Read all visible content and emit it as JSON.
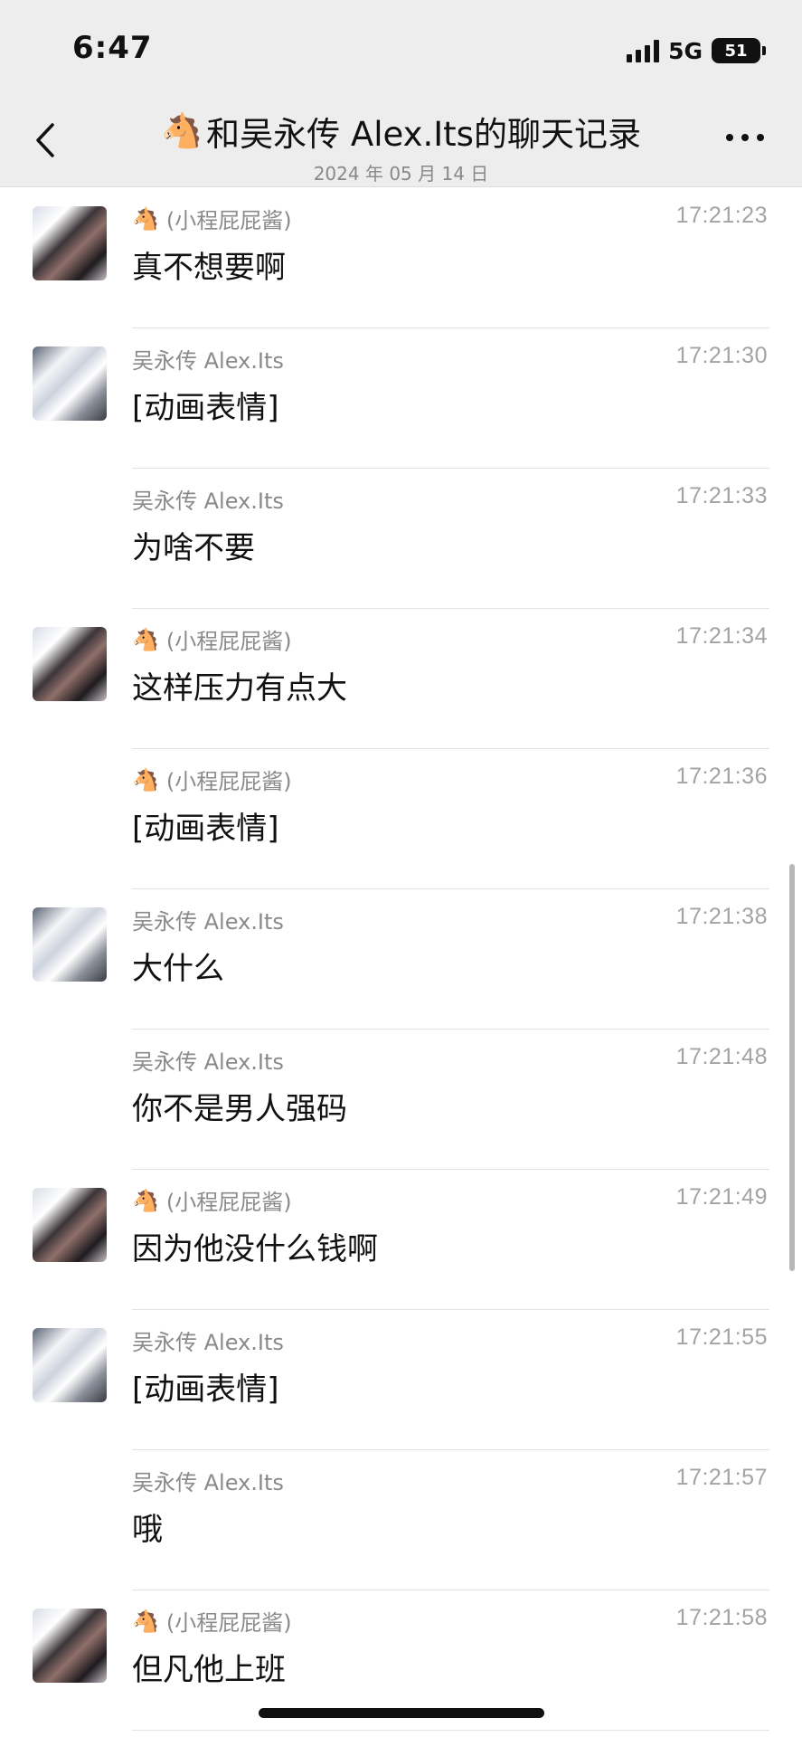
{
  "status_bar": {
    "time": "6:47",
    "network": "5G",
    "battery": "51"
  },
  "header": {
    "title_emoji": "🐴",
    "title": "和吴永传 Alex.Its的聊天记录",
    "date": "2024 年 05 月 14 日"
  },
  "messages": [
    {
      "avatar": "avatar-dark",
      "emoji": "🐴",
      "sender": "(小程屁屁酱)",
      "time": "17:21:23",
      "text": "真不想要啊"
    },
    {
      "avatar": "avatar-white",
      "emoji": "",
      "sender": "吴永传 Alex.Its",
      "time": "17:21:30",
      "text": "[动画表情]"
    },
    {
      "avatar": "",
      "emoji": "",
      "sender": "吴永传 Alex.Its",
      "time": "17:21:33",
      "text": "为啥不要"
    },
    {
      "avatar": "avatar-dark",
      "emoji": "🐴",
      "sender": "(小程屁屁酱)",
      "time": "17:21:34",
      "text": "这样压力有点大"
    },
    {
      "avatar": "",
      "emoji": "🐴",
      "sender": "(小程屁屁酱)",
      "time": "17:21:36",
      "text": "[动画表情]"
    },
    {
      "avatar": "avatar-white",
      "emoji": "",
      "sender": "吴永传 Alex.Its",
      "time": "17:21:38",
      "text": "大什么"
    },
    {
      "avatar": "",
      "emoji": "",
      "sender": "吴永传 Alex.Its",
      "time": "17:21:48",
      "text": "你不是男人强码"
    },
    {
      "avatar": "avatar-dark",
      "emoji": "🐴",
      "sender": "(小程屁屁酱)",
      "time": "17:21:49",
      "text": "因为他没什么钱啊"
    },
    {
      "avatar": "avatar-white",
      "emoji": "",
      "sender": "吴永传 Alex.Its",
      "time": "17:21:55",
      "text": "[动画表情]"
    },
    {
      "avatar": "",
      "emoji": "",
      "sender": "吴永传 Alex.Its",
      "time": "17:21:57",
      "text": "哦"
    },
    {
      "avatar": "avatar-dark",
      "emoji": "🐴",
      "sender": "(小程屁屁酱)",
      "time": "17:21:58",
      "text": "但凡他上班"
    }
  ]
}
